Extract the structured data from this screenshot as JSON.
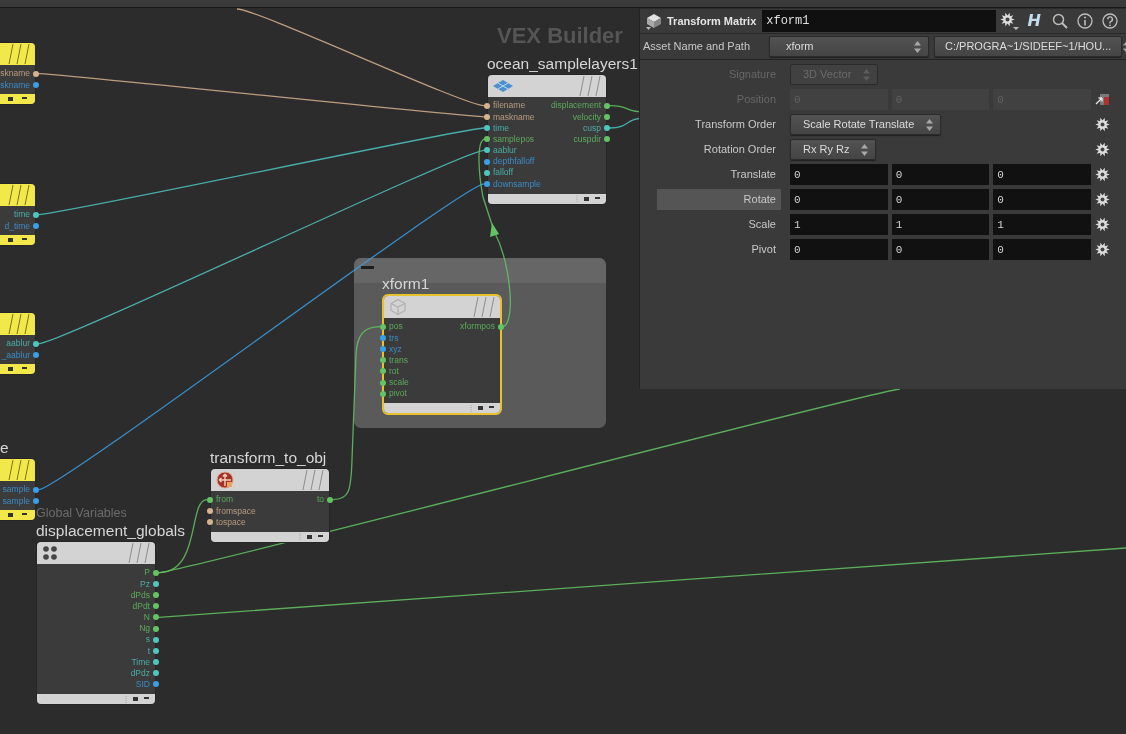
{
  "network": {
    "context_label": "VEX Builder"
  },
  "nodes": [
    {
      "kind": "parameter",
      "selected": false,
      "outputs": [
        {
          "label": "skname",
          "color": "#d6b38e"
        },
        {
          "label": "skname",
          "color": "#3a9fe6"
        }
      ]
    },
    {
      "kind": "ocean",
      "name": "ocean_samplelayers1",
      "selected": false,
      "inputs": [
        {
          "label": "filename",
          "color": "#d6b38e"
        },
        {
          "label": "maskname",
          "color": "#d6b38e"
        },
        {
          "label": "time",
          "color": "#4ec7bf"
        },
        {
          "label": "samplepos",
          "color": "#63c463"
        },
        {
          "label": "aablur",
          "color": "#4ec7bf"
        },
        {
          "label": "depthfalloff",
          "color": "#3a9fe6"
        },
        {
          "label": "falloff",
          "color": "#4ec7bf"
        },
        {
          "label": "downsample",
          "color": "#3a9fe6"
        }
      ],
      "outputs": [
        {
          "label": "displacement",
          "color": "#63c463"
        },
        {
          "label": "velocity",
          "color": "#63c463"
        },
        {
          "label": "cusp",
          "color": "#4ec7bf"
        },
        {
          "label": "cuspdir",
          "color": "#63c463"
        }
      ]
    },
    {
      "kind": "parameter",
      "selected": false,
      "outputs": [
        {
          "label": "time",
          "color": "#4ec7bf"
        },
        {
          "label": "d_time",
          "color": "#3a9fe6"
        }
      ]
    },
    {
      "kind": "parameter",
      "selected": false,
      "outputs": [
        {
          "label": "aablur",
          "color": "#4ec7bf"
        },
        {
          "label": "_aablur",
          "color": "#3a9fe6"
        }
      ]
    },
    {
      "kind": "parameter",
      "name": "e",
      "selected": false,
      "outputs": [
        {
          "label": "sample",
          "color": "#3a9fe6"
        },
        {
          "label": "sample",
          "color": "#3a9fe6"
        }
      ]
    },
    {
      "kind": "spacechange",
      "name": "transform_to_obj",
      "selected": false,
      "inputs": [
        {
          "label": "from",
          "color": "#63c463"
        },
        {
          "label": "fromspace",
          "color": "#d6b38e"
        },
        {
          "label": "tospace",
          "color": "#d6b38e"
        }
      ],
      "outputs": [
        {
          "label": "to",
          "color": "#63c463"
        }
      ]
    },
    {
      "kind": "globals",
      "subtitle": "Global Variables",
      "name": "displacement_globals",
      "selected": false,
      "outputs": [
        {
          "label": "P",
          "color": "#63c463"
        },
        {
          "label": "Pz",
          "color": "#4ec7bf"
        },
        {
          "label": "dPds",
          "color": "#63c463"
        },
        {
          "label": "dPdt",
          "color": "#63c463"
        },
        {
          "label": "N",
          "color": "#63c463"
        },
        {
          "label": "Ng",
          "color": "#63c463"
        },
        {
          "label": "s",
          "color": "#4ec7bf"
        },
        {
          "label": "t",
          "color": "#4ec7bf"
        },
        {
          "label": "Time",
          "color": "#4ec7bf"
        },
        {
          "label": "dPdz",
          "color": "#4ec7bf"
        },
        {
          "label": "SID",
          "color": "#3a9fe6"
        }
      ]
    }
  ],
  "network_boxes": [
    {
      "nodes": [
        {
          "kind": "xform",
          "name": "xform1",
          "selected": true,
          "inputs": [
            {
              "label": "pos",
              "color": "#63c463"
            },
            {
              "label": "trs",
              "color": "#3a9fe6"
            },
            {
              "label": "xyz",
              "color": "#3a9fe6"
            },
            {
              "label": "trans",
              "color": "#63c463"
            },
            {
              "label": "rot",
              "color": "#63c463"
            },
            {
              "label": "scale",
              "color": "#63c463"
            },
            {
              "label": "pivot",
              "color": "#63c463"
            }
          ],
          "outputs": [
            {
              "label": "xformpos",
              "color": "#63c463"
            }
          ]
        }
      ]
    }
  ],
  "parameter_panel": {
    "type_label": "Transform Matrix",
    "node_name": "xform1",
    "letter_button": "H",
    "asset_label": "Asset Name and Path",
    "asset_name": "xform",
    "asset_path": "C:/PROGRA~1/SIDEEF~1/HOU...",
    "parameters": [
      {
        "kind": "menu",
        "label": "Signature",
        "value": "3D Vector",
        "disabled": true,
        "highlighted": false
      },
      {
        "kind": "vector",
        "label": "Position",
        "values": [
          "0",
          "0",
          "0"
        ],
        "disabled": true,
        "highlighted": false,
        "side_button": {
          "kind": "handle"
        }
      },
      {
        "kind": "menu",
        "label": "Transform Order",
        "value": "Scale Rotate Translate",
        "disabled": false,
        "highlighted": false,
        "side_button": {
          "kind": "gear"
        }
      },
      {
        "kind": "menu",
        "label": "Rotation Order",
        "value": "Rx Ry Rz",
        "disabled": false,
        "highlighted": false,
        "side_button": {
          "kind": "gear"
        }
      },
      {
        "kind": "vector",
        "label": "Translate",
        "values": [
          "0",
          "0",
          "0"
        ],
        "disabled": false,
        "highlighted": false,
        "side_button": {
          "kind": "gear"
        }
      },
      {
        "kind": "vector",
        "label": "Rotate",
        "values": [
          "0",
          "0",
          "0"
        ],
        "disabled": false,
        "highlighted": true,
        "side_button": {
          "kind": "gear"
        }
      },
      {
        "kind": "vector",
        "label": "Scale",
        "values": [
          "1",
          "1",
          "1"
        ],
        "disabled": false,
        "highlighted": false,
        "side_button": {
          "kind": "gear"
        }
      },
      {
        "kind": "vector",
        "label": "Pivot",
        "values": [
          "0",
          "0",
          "0"
        ],
        "disabled": false,
        "highlighted": false,
        "side_button": {
          "kind": "gear"
        }
      }
    ]
  }
}
